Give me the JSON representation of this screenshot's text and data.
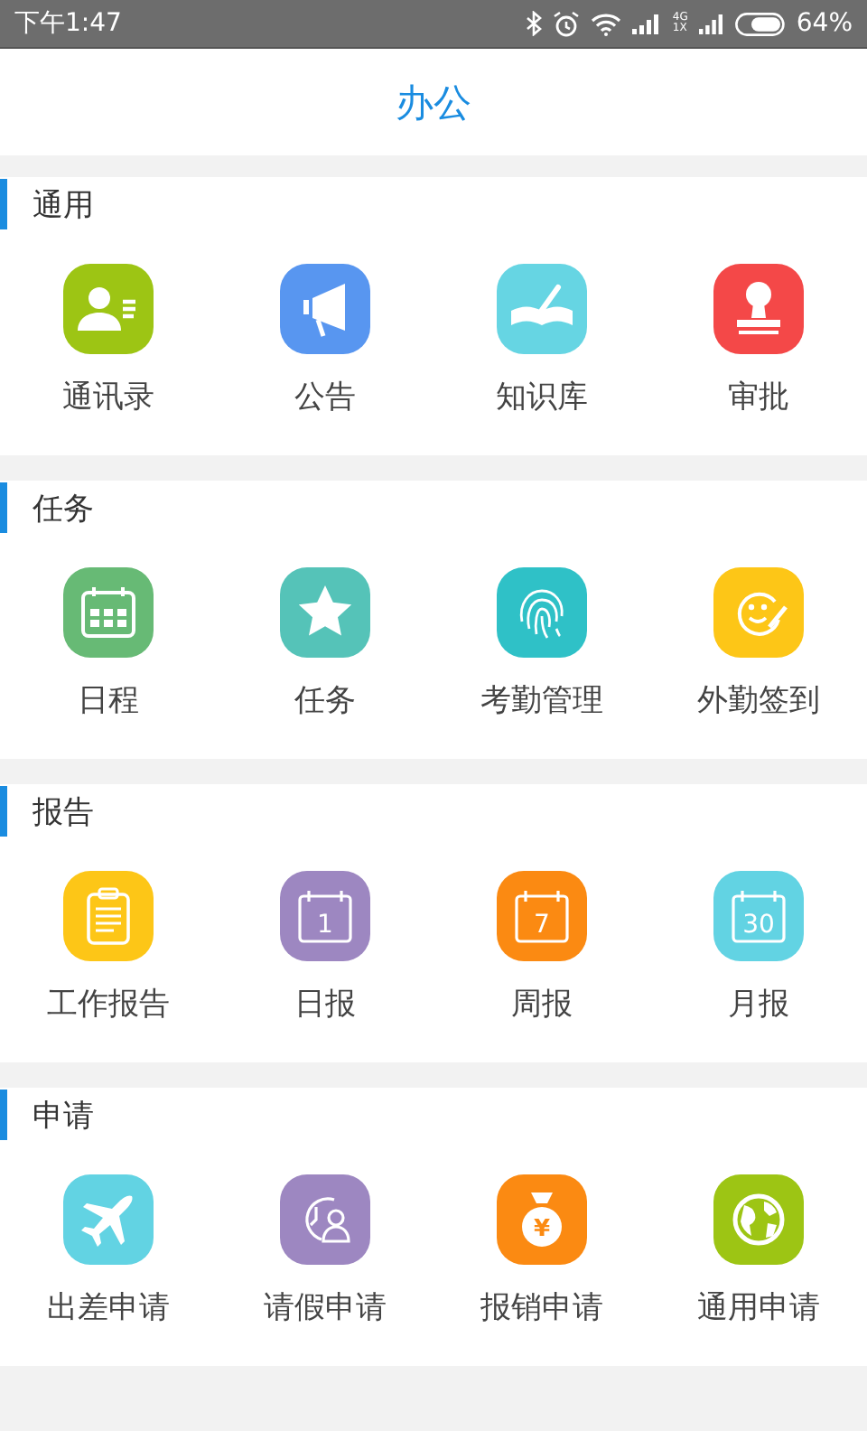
{
  "status_bar": {
    "time": "下午1:47",
    "network_top": "4G",
    "network_bottom": "1X",
    "battery": "64%"
  },
  "header": {
    "title": "办公"
  },
  "sections": [
    {
      "title": "通用",
      "items": [
        {
          "label": "通讯录",
          "kind": "contacts",
          "color": "#9dc514"
        },
        {
          "label": "公告",
          "kind": "megaphone",
          "color": "#5896f0"
        },
        {
          "label": "知识库",
          "kind": "book",
          "color": "#66d5e3"
        },
        {
          "label": "审批",
          "kind": "stamp",
          "color": "#f44848"
        }
      ]
    },
    {
      "title": "任务",
      "items": [
        {
          "label": "日程",
          "kind": "calendar",
          "color": "#67ba75"
        },
        {
          "label": "任务",
          "kind": "star",
          "color": "#55c3b8"
        },
        {
          "label": "考勤管理",
          "kind": "fingerprint",
          "color": "#2fc1c7"
        },
        {
          "label": "外勤签到",
          "kind": "smiley",
          "color": "#fdc617"
        }
      ]
    },
    {
      "title": "报告",
      "items": [
        {
          "label": "工作报告",
          "kind": "clipboard",
          "color": "#fdc617"
        },
        {
          "label": "日报",
          "kind": "date",
          "icon_text": "1",
          "color": "#9d87c1"
        },
        {
          "label": "周报",
          "kind": "date",
          "icon_text": "7",
          "color": "#fb8a12"
        },
        {
          "label": "月报",
          "kind": "date",
          "icon_text": "30",
          "color": "#62d3e3"
        }
      ]
    },
    {
      "title": "申请",
      "items": [
        {
          "label": "出差申请",
          "kind": "plane",
          "color": "#62d3e3"
        },
        {
          "label": "请假申请",
          "kind": "leave",
          "color": "#9d87c1"
        },
        {
          "label": "报销申请",
          "kind": "bag",
          "icon_text": "¥",
          "color": "#fb8a12"
        },
        {
          "label": "通用申请",
          "kind": "globe",
          "color": "#9dc514"
        }
      ]
    }
  ]
}
